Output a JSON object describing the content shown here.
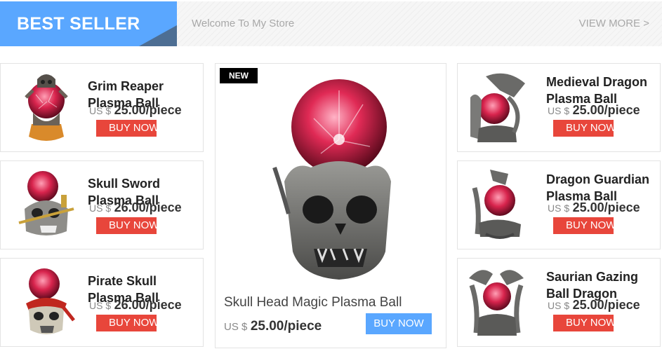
{
  "header": {
    "title": "BEST SELLER",
    "welcome": "Welcome To My Store",
    "view_more": "VIEW MORE >"
  },
  "colors": {
    "accent_blue": "#5aa7ff",
    "buy_red": "#e8463b",
    "badge_black": "#000000"
  },
  "left_products": [
    {
      "name": "Grim Reaper Plasma Ball",
      "currency": "US $",
      "price": "25.00/piece",
      "buy_label": "BUY NOW"
    },
    {
      "name": "Skull Sword Plasma Ball",
      "currency": "US $",
      "price": "26.00/piece",
      "buy_label": "BUY NOW"
    },
    {
      "name": "Pirate Skull Plasma Ball",
      "currency": "US $",
      "price": "26.00/piece",
      "buy_label": "BUY NOW"
    }
  ],
  "featured": {
    "badge": "NEW",
    "name": "Skull Head Magic Plasma Ball",
    "currency": "US $",
    "price": "25.00/piece",
    "buy_label": "BUY NOW"
  },
  "right_products": [
    {
      "name": "Medieval Dragon Plasma Ball",
      "currency": "US $",
      "price": "25.00/piece",
      "buy_label": "BUY NOW"
    },
    {
      "name": "Dragon Guardian Plasma Ball",
      "currency": "US $",
      "price": "25.00/piece",
      "buy_label": "BUY NOW"
    },
    {
      "name": "Saurian Gazing Ball Dragon",
      "currency": "US $",
      "price": "25.00/piece",
      "buy_label": "BUY NOW"
    }
  ]
}
